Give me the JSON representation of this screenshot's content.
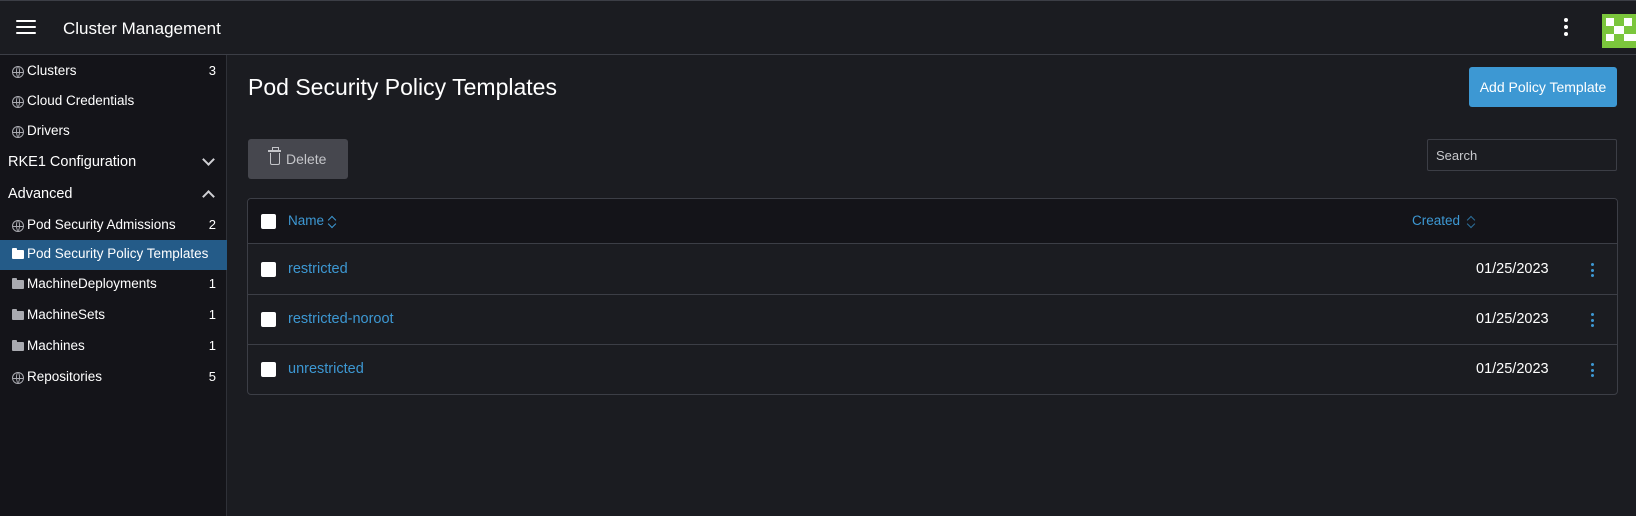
{
  "header": {
    "title": "Cluster Management",
    "menu_icon": "hamburger-icon",
    "more_icon": "kebab-icon",
    "brand_color": "#7bc63c"
  },
  "sidebar": {
    "items": [
      {
        "label": "Clusters",
        "count": "3",
        "icon": "globe-icon"
      },
      {
        "label": "Cloud Credentials",
        "count": "",
        "icon": "globe-icon"
      },
      {
        "label": "Drivers",
        "count": "",
        "icon": "globe-icon"
      }
    ],
    "groups": [
      {
        "label": "RKE1 Configuration",
        "expanded": false
      },
      {
        "label": "Advanced",
        "expanded": true
      }
    ],
    "advanced_items": [
      {
        "label": "Pod Security Admissions",
        "count": "2",
        "icon": "globe-icon"
      },
      {
        "label": "Pod Security Policy Templates",
        "count": "",
        "icon": "folder-icon",
        "active": true
      },
      {
        "label": "MachineDeployments",
        "count": "1",
        "icon": "folder-icon"
      },
      {
        "label": "MachineSets",
        "count": "1",
        "icon": "folder-icon"
      },
      {
        "label": "Machines",
        "count": "1",
        "icon": "folder-icon"
      },
      {
        "label": "Repositories",
        "count": "5",
        "icon": "globe-icon"
      }
    ],
    "active_color": "#245b88"
  },
  "main": {
    "title": "Pod Security Policy Templates",
    "add_button": "Add Policy Template",
    "delete_button": "Delete",
    "search_placeholder": "Search",
    "accent_color": "#3d98d3",
    "table": {
      "columns": [
        "Name",
        "Created"
      ],
      "rows": [
        {
          "name": "restricted",
          "created": "01/25/2023"
        },
        {
          "name": "restricted-noroot",
          "created": "01/25/2023"
        },
        {
          "name": "unrestricted",
          "created": "01/25/2023"
        }
      ]
    }
  }
}
